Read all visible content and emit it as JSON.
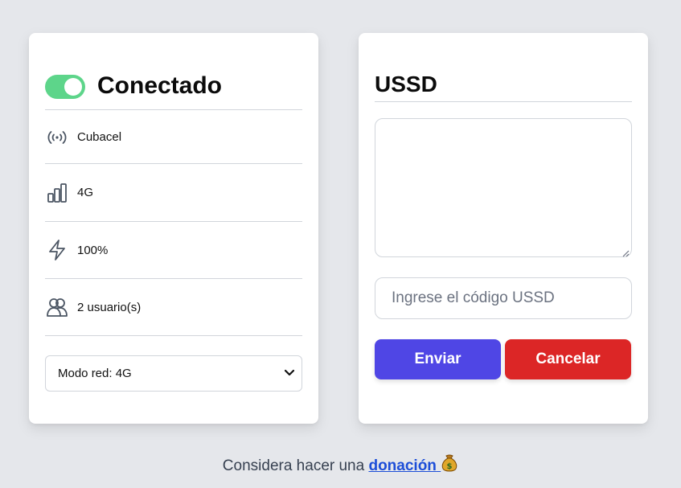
{
  "status": {
    "connected": true,
    "title": "Conectado",
    "toggle_color": "#5dd58a"
  },
  "info": {
    "carrier": {
      "icon": "signal-broadcast-icon",
      "label": "Cubacel"
    },
    "network": {
      "icon": "signal-bars-icon",
      "label": "4G"
    },
    "battery": {
      "icon": "lightning-icon",
      "label": "100%"
    },
    "users": {
      "icon": "users-icon",
      "label": "2 usuario(s)"
    }
  },
  "network_mode": {
    "selected": "Modo red: 4G"
  },
  "ussd": {
    "title": "USSD",
    "response_text": "",
    "input_placeholder": "Ingrese el código USSD",
    "input_value": "",
    "send_label": "Enviar",
    "cancel_label": "Cancelar",
    "send_color": "#4f46e5",
    "cancel_color": "#dc2626"
  },
  "footer": {
    "prefix": "Considera hacer una ",
    "link_label": "donación",
    "link_icon": "money-bag-icon"
  }
}
